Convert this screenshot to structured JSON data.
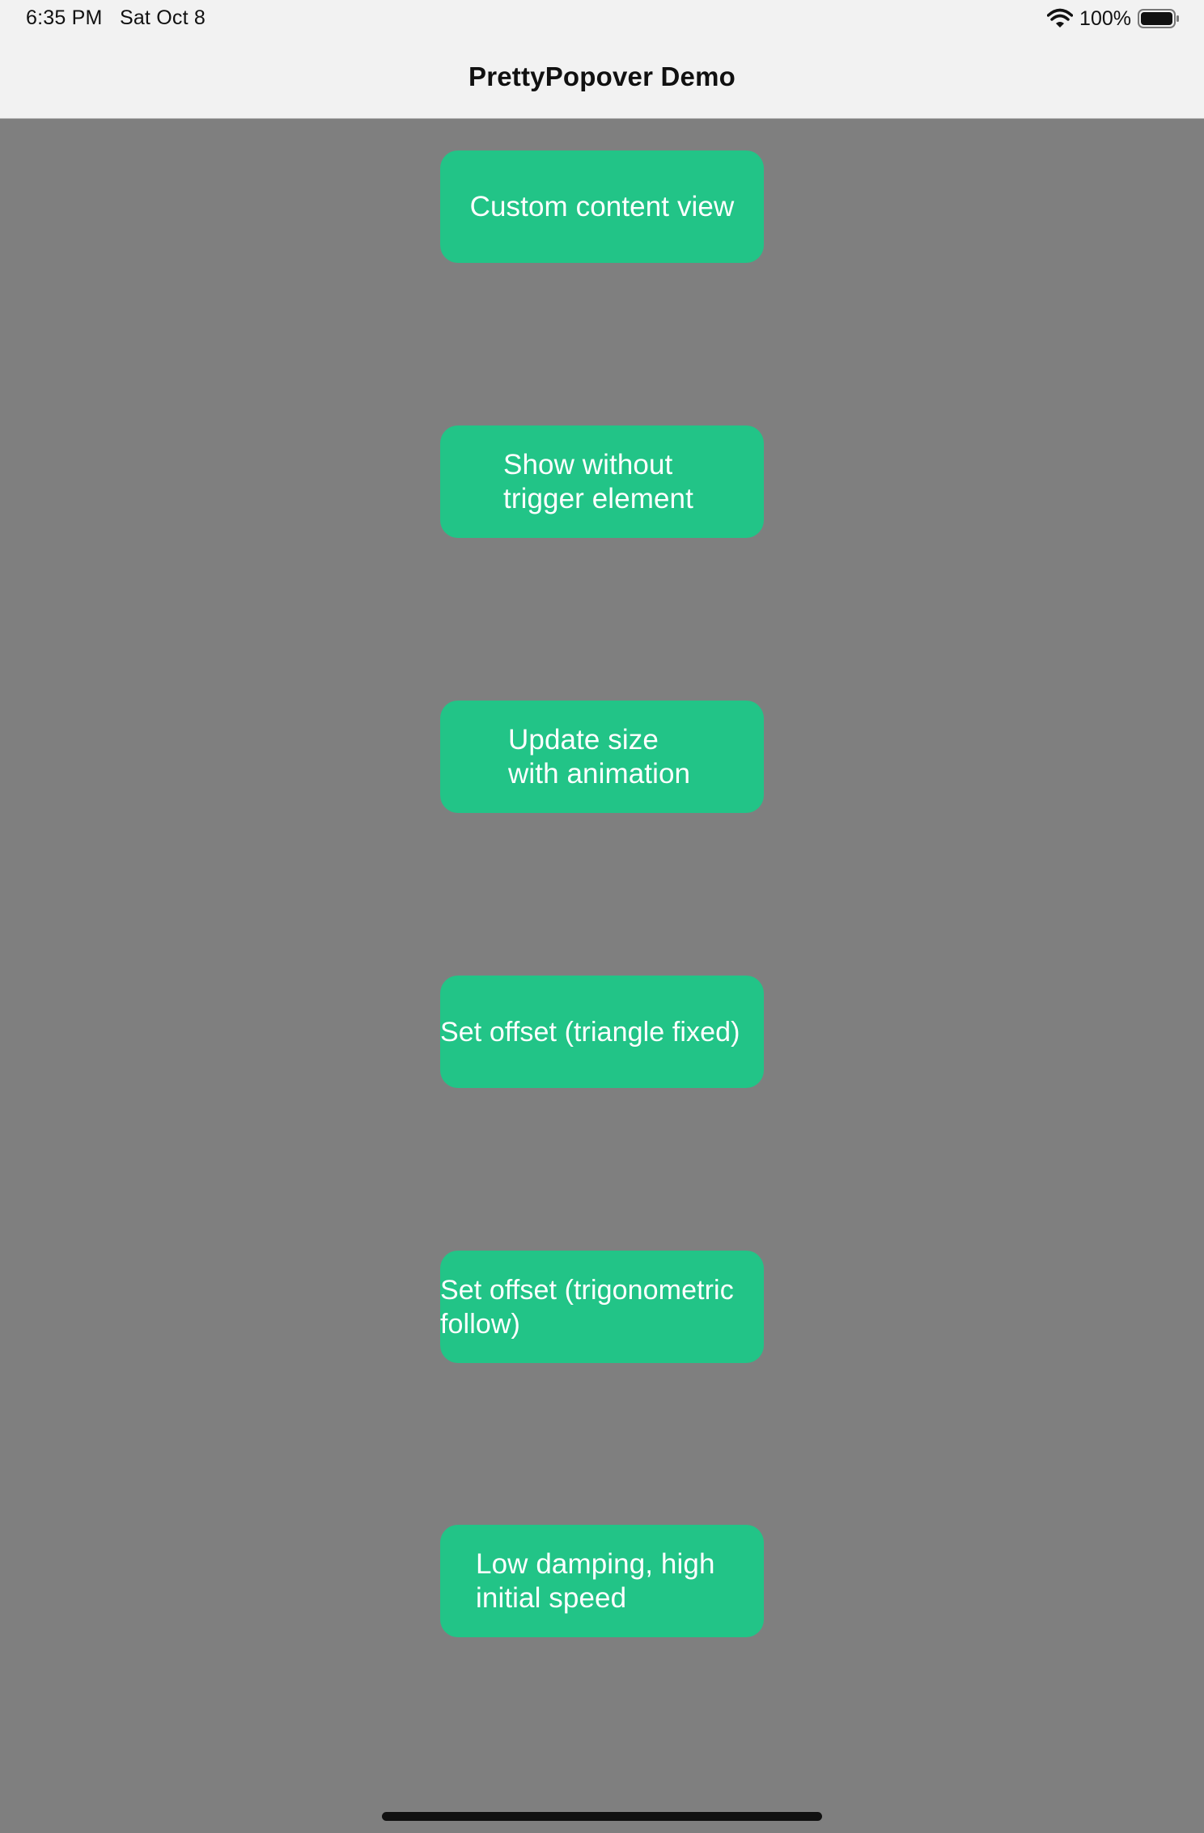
{
  "status_bar": {
    "time": "6:35 PM",
    "date": "Sat Oct 8",
    "battery_percent": "100%",
    "icons": [
      "wifi-icon",
      "battery-icon"
    ]
  },
  "navigation": {
    "title": "PrettyPopover Demo"
  },
  "buttons": [
    {
      "label": "Custom content view"
    },
    {
      "label": "Show without\ntrigger element"
    },
    {
      "label": "Update size\nwith animation"
    },
    {
      "label": "Set offset (triangle fixed)"
    },
    {
      "label": "Set offset (trigonometric\nfollow)"
    },
    {
      "label": "Low damping, high\ninitial speed"
    }
  ],
  "colors": {
    "background": "#7f7f7f",
    "bar_background": "#f2f2f2",
    "button": "#22c487",
    "button_text": "#ffffff",
    "text_dark": "#111111"
  }
}
